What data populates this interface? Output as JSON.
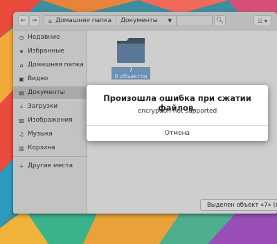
{
  "window": {
    "breadcrumb_home": "Домашняя папка",
    "breadcrumb_current": "Документы"
  },
  "sidebar": {
    "items": [
      {
        "label": "Недавние",
        "icon": "clock-icon"
      },
      {
        "label": "Избранные",
        "icon": "star-icon"
      },
      {
        "label": "Домашняя папка",
        "icon": "home-icon"
      },
      {
        "label": "Видео",
        "icon": "video-icon"
      },
      {
        "label": "Документы",
        "icon": "document-icon"
      },
      {
        "label": "Загрузки",
        "icon": "download-icon"
      },
      {
        "label": "Изображения",
        "icon": "image-icon"
      },
      {
        "label": "Музыка",
        "icon": "music-icon"
      },
      {
        "label": "Корзина",
        "icon": "trash-icon"
      }
    ],
    "other_places": "Другие места"
  },
  "content": {
    "folder_name": "7",
    "folder_subtitle": "0 объектов"
  },
  "status": {
    "text": "Выделен объект «7» (в"
  },
  "dialog": {
    "title": "Произошла ошибка при сжатии файлов.",
    "message": "encryption not supported",
    "cancel": "Отмена"
  }
}
